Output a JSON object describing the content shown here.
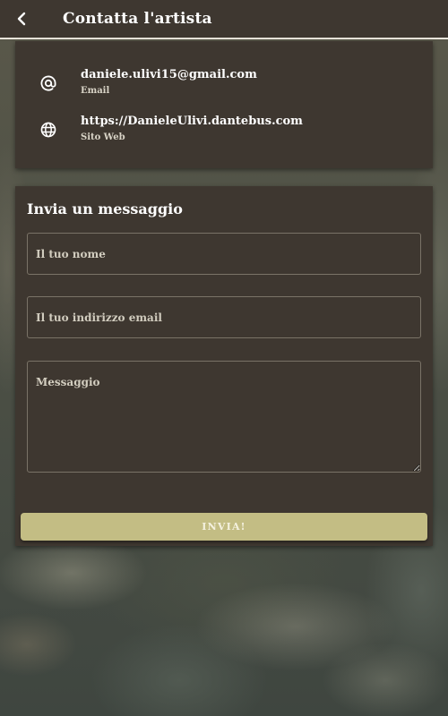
{
  "header": {
    "title": "Contatta l'artista",
    "back_icon": "chevron-left-icon"
  },
  "contacts": [
    {
      "icon": "at-sign-icon",
      "value": "daniele.ulivi15@gmail.com",
      "caption": "Email"
    },
    {
      "icon": "globe-icon",
      "value": "https://DanieleUlivi.dantebus.com",
      "caption": "Sito Web"
    }
  ],
  "message_form": {
    "title": "Invia un messaggio",
    "name_placeholder": "Il tuo nome",
    "email_placeholder": "Il tuo indirizzo email",
    "message_placeholder": "Messaggio",
    "send_label": "INVIA!"
  },
  "colors": {
    "card_background": "#3e3730",
    "button_accent": "#c3bd84",
    "header_divider": "#e8e4da"
  }
}
